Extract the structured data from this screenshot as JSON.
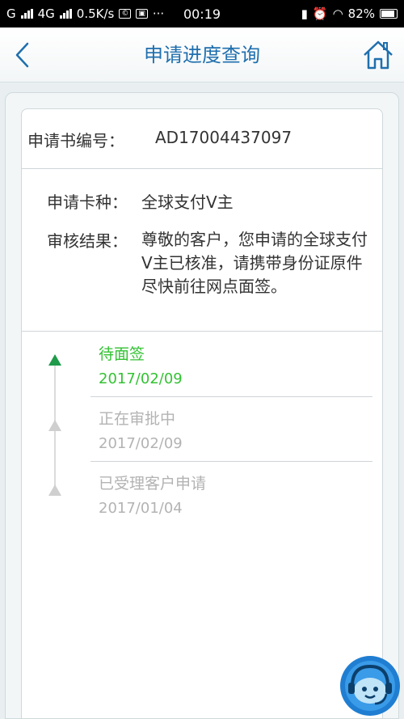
{
  "status_bar": {
    "carrier_g": "G",
    "net_type": "4G",
    "speed": "0.5K/s",
    "more": "···",
    "time": "00:19",
    "battery": "82%"
  },
  "header": {
    "title": "申请进度查询"
  },
  "application": {
    "number_label": "申请书编号：",
    "number_value": "AD17004437097",
    "card_type_label": "申请卡种：",
    "card_type_value": "全球支付V主",
    "result_label": "审核结果：",
    "result_value": "尊敬的客户，您申请的全球支付V主已核准，请携带身份证原件尽快前往网点面签。"
  },
  "timeline": [
    {
      "title": "待面签",
      "date": "2017/02/09",
      "status": "active"
    },
    {
      "title": "正在审批中",
      "date": "2017/02/09",
      "status": "done"
    },
    {
      "title": "已受理客户申请",
      "date": "2017/01/04",
      "status": "done"
    }
  ],
  "colors": {
    "accent": "#1f6fae",
    "active_green": "#33c233",
    "inactive_grey": "#b3b3b3"
  }
}
